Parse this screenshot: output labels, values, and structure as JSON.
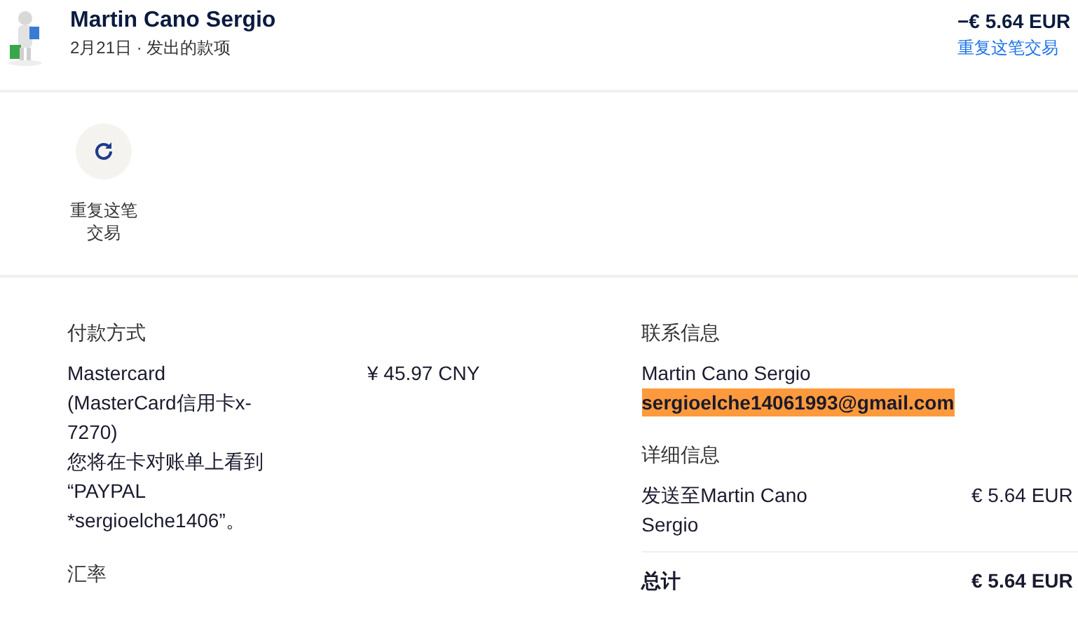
{
  "header": {
    "name": "Martin Cano Sergio",
    "subtitle": "2月21日 · 发出的款项",
    "amount": "−€ 5.64 EUR",
    "repeat_link": "重复这笔交易"
  },
  "repeat_action": {
    "label": "重复这笔交易"
  },
  "payment": {
    "heading": "付款方式",
    "method_lines": [
      "Mastercard",
      "(MasterCard信用卡x-",
      "7270)",
      "您将在卡对账单上看到",
      "“PAYPAL",
      "*sergioelche1406”。"
    ],
    "amount": "¥ 45.97 CNY"
  },
  "exchange": {
    "heading": "汇率"
  },
  "contact": {
    "heading": "联系信息",
    "name": "Martin Cano Sergio",
    "email": "sergioelche14061993@gmail.com",
    "email_highlighted": true
  },
  "details": {
    "heading": "详细信息",
    "rows": [
      {
        "label": "发送至Martin Cano Sergio",
        "amount": "€ 5.64 EUR",
        "kind": "line"
      },
      {
        "label": "总计",
        "amount": "€ 5.64 EUR",
        "kind": "total"
      }
    ]
  }
}
